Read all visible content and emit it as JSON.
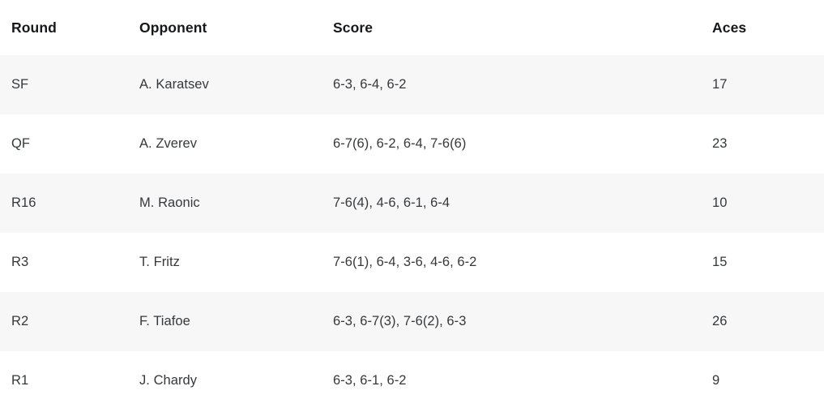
{
  "table": {
    "columns": [
      {
        "key": "round",
        "label": "Round"
      },
      {
        "key": "opponent",
        "label": "Opponent"
      },
      {
        "key": "score",
        "label": "Score"
      },
      {
        "key": "aces",
        "label": "Aces"
      }
    ],
    "rows": [
      {
        "round": "SF",
        "opponent": "A. Karatsev",
        "score": "6-3, 6-4, 6-2",
        "aces": "17"
      },
      {
        "round": "QF",
        "opponent": "A. Zverev",
        "score": "6-7(6), 6-2, 6-4, 7-6(6)",
        "aces": "23"
      },
      {
        "round": "R16",
        "opponent": "M. Raonic",
        "score": "7-6(4), 4-6, 6-1, 6-4",
        "aces": "10"
      },
      {
        "round": "R3",
        "opponent": "T. Fritz",
        "score": "7-6(1), 6-4, 3-6, 4-6, 6-2",
        "aces": "15"
      },
      {
        "round": "R2",
        "opponent": "F. Tiafoe",
        "score": "6-3, 6-7(3), 7-6(2), 6-3",
        "aces": "26"
      },
      {
        "round": "R1",
        "opponent": "J. Chardy",
        "score": "6-3, 6-1, 6-2",
        "aces": "9"
      }
    ]
  },
  "colors": {
    "background": "#ffffff",
    "stripe": "#f7f7f7",
    "header_text": "#17181a",
    "body_text": "#36383b"
  }
}
